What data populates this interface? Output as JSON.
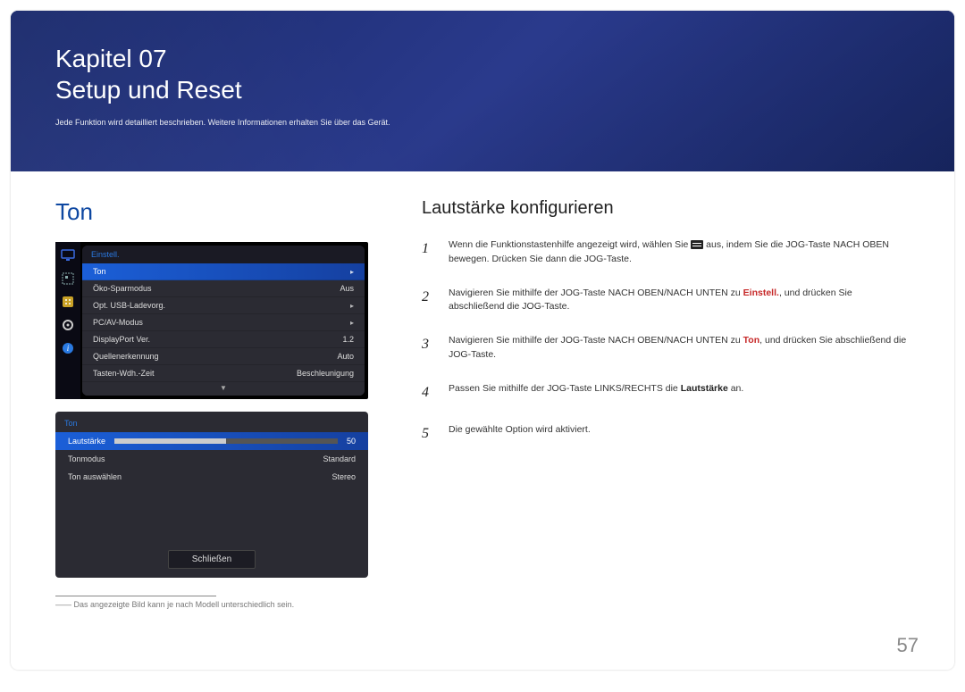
{
  "header": {
    "chapter_line": "Kapitel 07",
    "title": "Setup und Reset",
    "subtitle": "Jede Funktion wird detailliert beschrieben. Weitere Informationen erhalten Sie über das Gerät."
  },
  "left": {
    "heading": "Ton",
    "osd_main": {
      "title": "Einstell.",
      "rows": [
        {
          "label": "Ton",
          "value": "",
          "chevron": true,
          "selected": true
        },
        {
          "label": "Öko-Sparmodus",
          "value": "Aus",
          "chevron": false,
          "selected": false
        },
        {
          "label": "Opt. USB-Ladevorg.",
          "value": "",
          "chevron": true,
          "selected": false
        },
        {
          "label": "PC/AV-Modus",
          "value": "",
          "chevron": true,
          "selected": false
        },
        {
          "label": "DisplayPort Ver.",
          "value": "1.2",
          "chevron": false,
          "selected": false
        },
        {
          "label": "Quellenerkennung",
          "value": "Auto",
          "chevron": false,
          "selected": false
        },
        {
          "label": "Tasten-Wdh.-Zeit",
          "value": "Beschleunigung",
          "chevron": false,
          "selected": false
        }
      ],
      "sidebar_icons": [
        "monitor",
        "picture",
        "eco",
        "gear",
        "info"
      ]
    },
    "osd_sub": {
      "title": "Ton",
      "rows": [
        {
          "label": "Lautstärke",
          "value": "50",
          "selected": true,
          "bar": true
        },
        {
          "label": "Tonmodus",
          "value": "Standard",
          "selected": false
        },
        {
          "label": "Ton auswählen",
          "value": "Stereo",
          "selected": false
        }
      ],
      "close_label": "Schließen"
    },
    "footnote_prefix": "――",
    "footnote": "Das angezeigte Bild kann je nach Modell unterschiedlich sein."
  },
  "right": {
    "heading": "Lautstärke konfigurieren",
    "steps": [
      {
        "num": "1",
        "pre": "Wenn die Funktionstastenhilfe angezeigt wird, wählen Sie ",
        "icon": true,
        "post": " aus, indem Sie die JOG-Taste NACH OBEN bewegen. Drücken Sie dann die JOG-Taste."
      },
      {
        "num": "2",
        "pre": "Navigieren Sie mithilfe der JOG-Taste NACH OBEN/NACH UNTEN zu ",
        "kw": "Einstell.",
        "post": ", und drücken Sie abschließend die JOG-Taste."
      },
      {
        "num": "3",
        "pre": "Navigieren Sie mithilfe der JOG-Taste NACH OBEN/NACH UNTEN zu ",
        "kw": "Ton",
        "post": ", und drücken Sie abschließend die JOG-Taste."
      },
      {
        "num": "4",
        "pre": "Passen Sie mithilfe der JOG-Taste LINKS/RECHTS die ",
        "bold": "Lautstärke",
        "post": " an."
      },
      {
        "num": "5",
        "pre": "Die gewählte Option wird aktiviert.",
        "post": ""
      }
    ]
  },
  "page_number": "57"
}
